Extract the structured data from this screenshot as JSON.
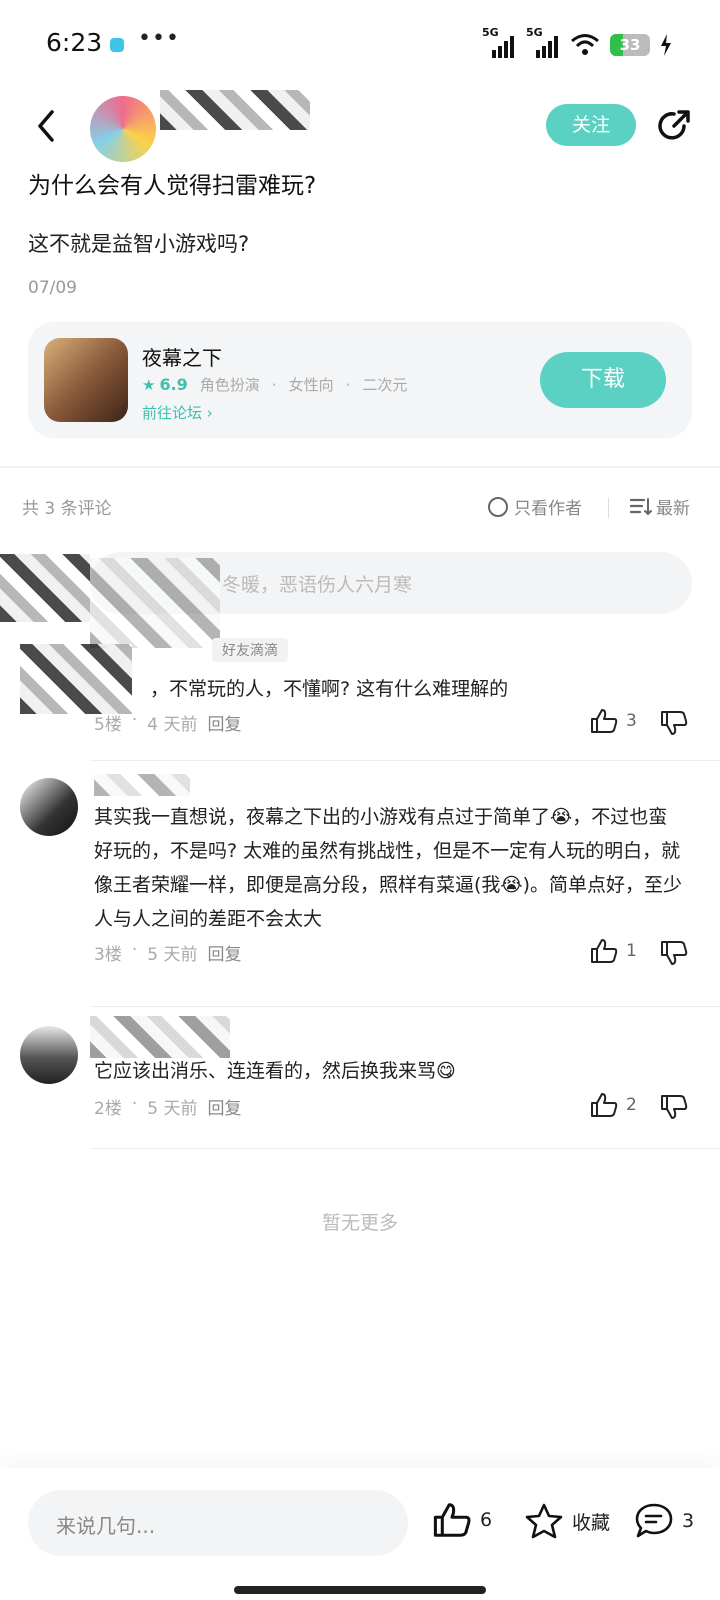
{
  "status_bar": {
    "time": "6:23",
    "dots": "•••",
    "signal_label_1": "5G",
    "signal_label_2": "5G",
    "battery": "33",
    "battery_level": 0.33
  },
  "nav": {
    "follow_label": "关注"
  },
  "post": {
    "title": "为什么会有人觉得扫雷难玩?",
    "body": "这不就是益智小游戏吗?",
    "date": "07/09"
  },
  "game_card": {
    "name": "夜幕之下",
    "rating": "6.9",
    "tags": [
      "角色扮演",
      "·",
      "女性向",
      "·",
      "二次元"
    ],
    "forum_link": "前往论坛",
    "download_label": "下载"
  },
  "comments_header": {
    "count": "共 3 条评论",
    "author_only": "只看作者",
    "sort": "最新"
  },
  "comment_input_top": {
    "placeholder": "冬暖，恶语伤人六月寒"
  },
  "comments": [
    {
      "tag": "好友滴滴",
      "text": "，不常玩的人，不懂啊? 这有什么难理解的",
      "floor": "5楼",
      "sep": "·",
      "time": "4 天前",
      "reply": "回复",
      "likes": "3"
    },
    {
      "text": "其实我一直想说，夜幕之下出的小游戏有点过于简单了😭，不过也蛮好玩的，不是吗? 太难的虽然有挑战性，但是不一定有人玩的明白，就像王者荣耀一样，即便是高分段，照样有菜逼(我😭)。简单点好，至少人与人之间的差距不会太大",
      "floor": "3楼",
      "sep": "·",
      "time": "5 天前",
      "reply": "回复",
      "likes": "1"
    },
    {
      "text": "它应该出消乐、连连看的，然后换我来骂😋",
      "floor": "2楼",
      "sep": "·",
      "time": "5 天前",
      "reply": "回复",
      "likes": "2"
    }
  ],
  "no_more": "暂无更多",
  "bottom_bar": {
    "input_placeholder": "来说几句...",
    "likes": "6",
    "favorite_label": "收藏",
    "comments": "3"
  }
}
